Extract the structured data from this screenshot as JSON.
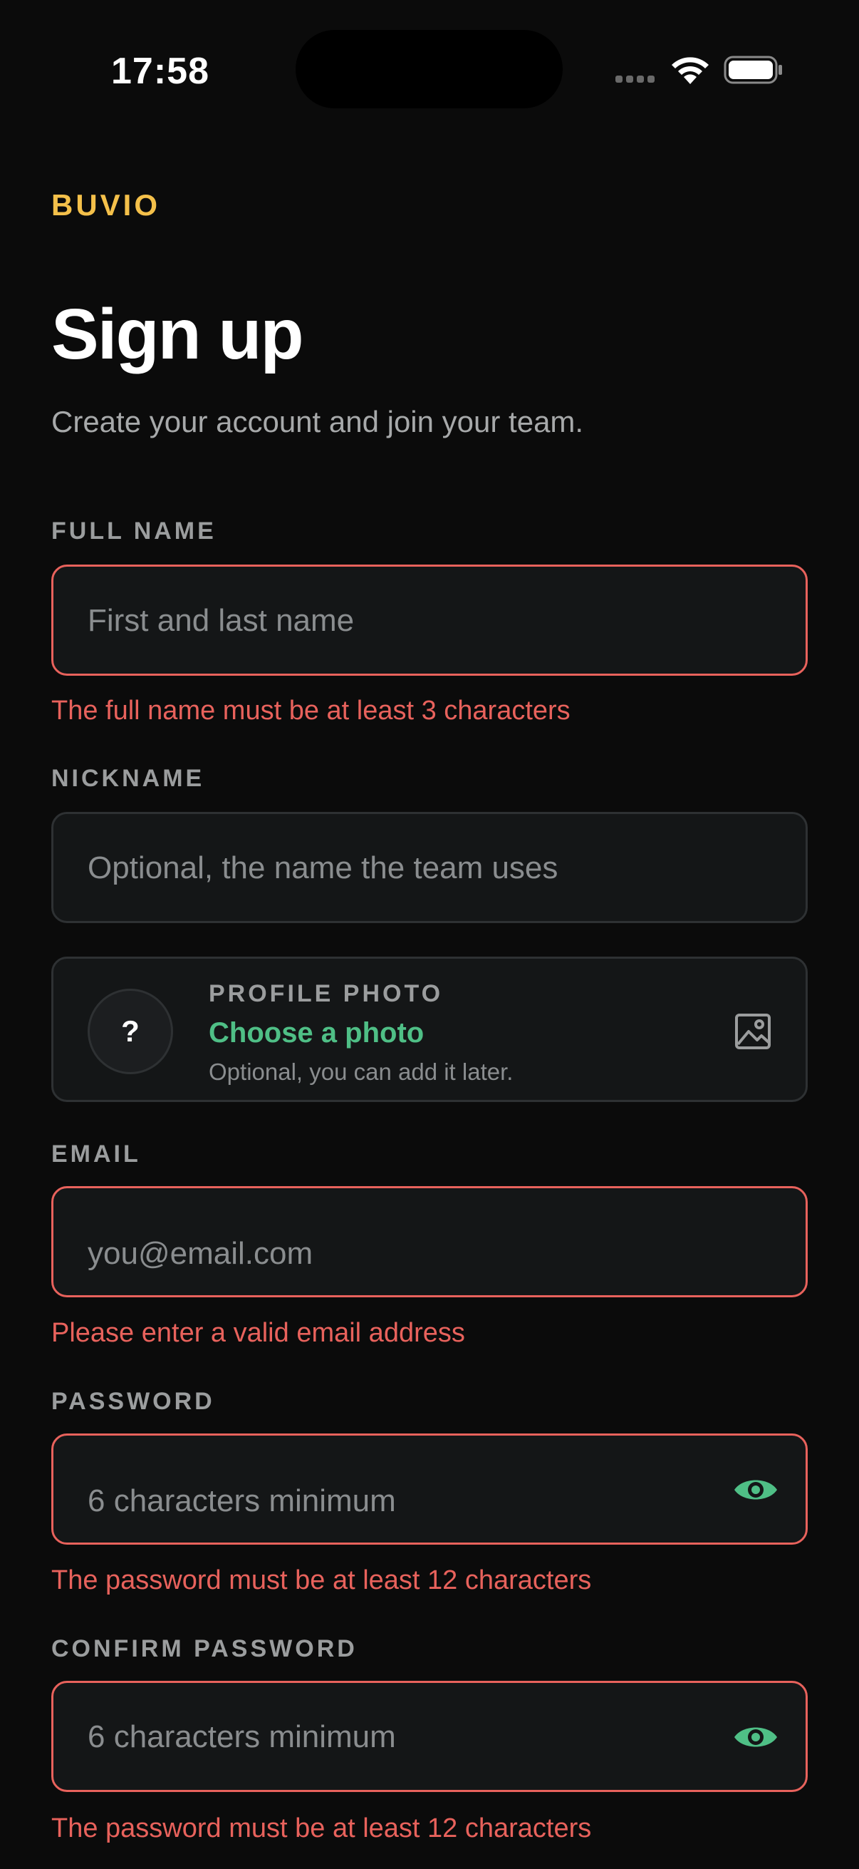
{
  "status_bar": {
    "time": "17:58"
  },
  "brand": "BUVIO",
  "title": "Sign up",
  "subtitle": "Create your account and join your team.",
  "full_name": {
    "label": "FULL NAME",
    "placeholder": "First and last name",
    "value": "",
    "error": "The full name must be at least 3 characters"
  },
  "nickname": {
    "label": "NICKNAME",
    "placeholder": "Optional, the name the team uses",
    "value": ""
  },
  "profile_photo": {
    "avatar_glyph": "?",
    "label": "PROFILE PHOTO",
    "action": "Choose a photo",
    "hint": "Optional, you can add it later."
  },
  "email": {
    "label": "EMAIL",
    "placeholder": "you@email.com",
    "value": "",
    "error": "Please enter a valid email address"
  },
  "password": {
    "label": "PASSWORD",
    "placeholder": "6 characters minimum",
    "value": "",
    "error": "The password must be at least 12 characters"
  },
  "confirm_password": {
    "label": "CONFIRM PASSWORD",
    "placeholder": "6 characters minimum",
    "value": "",
    "error": "The password must be at least 12 characters"
  },
  "icons": {
    "eye": "eye-icon",
    "image": "image-icon",
    "wifi": "wifi-icon",
    "battery": "battery-icon"
  },
  "colors": {
    "background": "#0b0b0b",
    "brand": "#f4c04a",
    "accent": "#4fbf86",
    "error": "#e8625c",
    "field_background": "#141617",
    "field_border": "#2e3133"
  }
}
